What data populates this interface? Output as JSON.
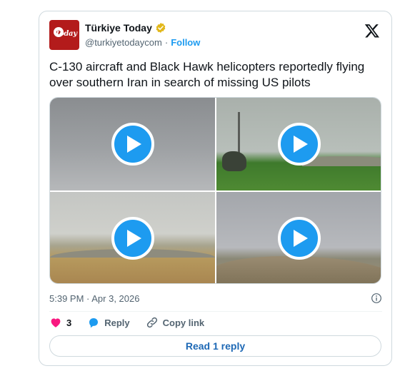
{
  "account": {
    "name": "Türkiye Today",
    "handle": "@turkiyetodaycom",
    "separator": "·",
    "follow_label": "Follow",
    "avatar_text": "Today",
    "verified_color": "#e2b719"
  },
  "tweet": {
    "text": "C-130 aircraft and Black Hawk helicopters reportedly flying over southern Iran in search of missing US pilots",
    "timestamp": "5:39 PM · Apr 3, 2026"
  },
  "media": {
    "tiles": [
      {
        "label": "video-1",
        "icon": "play-icon"
      },
      {
        "label": "video-2",
        "icon": "play-icon"
      },
      {
        "label": "video-3",
        "icon": "play-icon"
      },
      {
        "label": "video-4",
        "icon": "play-icon"
      }
    ]
  },
  "actions": {
    "like_count": "3",
    "reply_label": "Reply",
    "copy_link_label": "Copy link"
  },
  "read_replies_label": "Read 1 reply",
  "colors": {
    "accent": "#1d9bf0",
    "like": "#f91880",
    "muted": "#536471",
    "text": "#0f1419"
  }
}
